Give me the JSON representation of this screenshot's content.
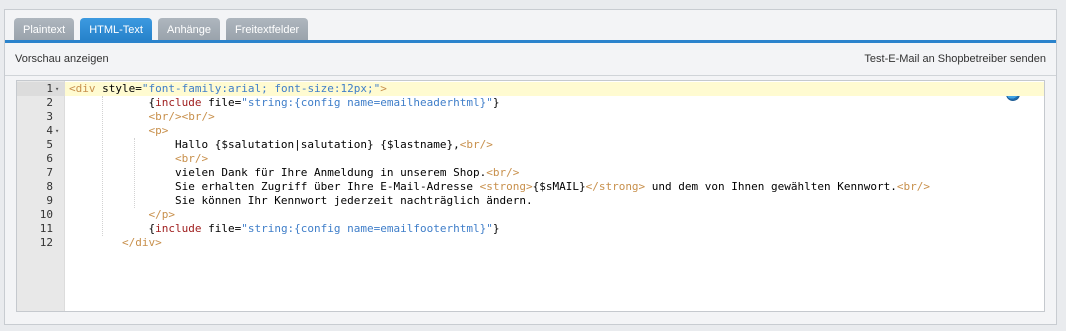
{
  "tabs": [
    {
      "label": "Plaintext",
      "active": false
    },
    {
      "label": "HTML-Text",
      "active": true
    },
    {
      "label": "Anhänge",
      "active": false
    },
    {
      "label": "Freitextfelder",
      "active": false
    }
  ],
  "toolbar": {
    "preview_label": "Vorschau anzeigen",
    "test_mail_label": "Test-E-Mail an Shopbetreiber senden"
  },
  "editor": {
    "line_numbers": [
      "1",
      "2",
      "3",
      "4",
      "5",
      "6",
      "7",
      "8",
      "9",
      "10",
      "11",
      "12"
    ],
    "foldable_lines": [
      1,
      4
    ],
    "active_line": 1,
    "lines": [
      [
        {
          "t": "tag",
          "v": "<div "
        },
        {
          "t": "attr",
          "v": "style="
        },
        {
          "t": "str",
          "v": "\"font-family:arial; font-size:12px;\""
        },
        {
          "t": "tag",
          "v": ">"
        }
      ],
      [
        {
          "t": "txt",
          "v": "            {"
        },
        {
          "t": "kw",
          "v": "include"
        },
        {
          "t": "txt",
          "v": " file="
        },
        {
          "t": "str",
          "v": "\"string:{config name=emailheaderhtml}\""
        },
        {
          "t": "txt",
          "v": "}"
        }
      ],
      [
        {
          "t": "tag",
          "v": "            <br/><br/>"
        }
      ],
      [
        {
          "t": "tag",
          "v": "            <p>"
        }
      ],
      [
        {
          "t": "txt",
          "v": "                Hallo {$salutation|salutation} {$lastname},"
        },
        {
          "t": "tag",
          "v": "<br/>"
        }
      ],
      [
        {
          "t": "tag",
          "v": "                <br/>"
        }
      ],
      [
        {
          "t": "txt",
          "v": "                vielen Dank für Ihre Anmeldung in unserem Shop."
        },
        {
          "t": "tag",
          "v": "<br/>"
        }
      ],
      [
        {
          "t": "txt",
          "v": "                Sie erhalten Zugriff über Ihre E-Mail-Adresse "
        },
        {
          "t": "tag",
          "v": "<strong>"
        },
        {
          "t": "txt",
          "v": "{$sMAIL}"
        },
        {
          "t": "tag",
          "v": "</strong>"
        },
        {
          "t": "txt",
          "v": " und dem von Ihnen gewählten Kennwort."
        },
        {
          "t": "tag",
          "v": "<br/>"
        }
      ],
      [
        {
          "t": "txt",
          "v": "                Sie können Ihr Kennwort jederzeit nachträglich ändern."
        }
      ],
      [
        {
          "t": "tag",
          "v": "            </p>"
        }
      ],
      [
        {
          "t": "txt",
          "v": "            {"
        },
        {
          "t": "kw",
          "v": "include"
        },
        {
          "t": "txt",
          "v": " file="
        },
        {
          "t": "str",
          "v": "\"string:{config name=emailfooterhtml}\""
        },
        {
          "t": "txt",
          "v": "}"
        }
      ],
      [
        {
          "t": "tag",
          "v": "        </div>"
        }
      ]
    ]
  },
  "icons": {
    "globe": "globe-icon"
  }
}
